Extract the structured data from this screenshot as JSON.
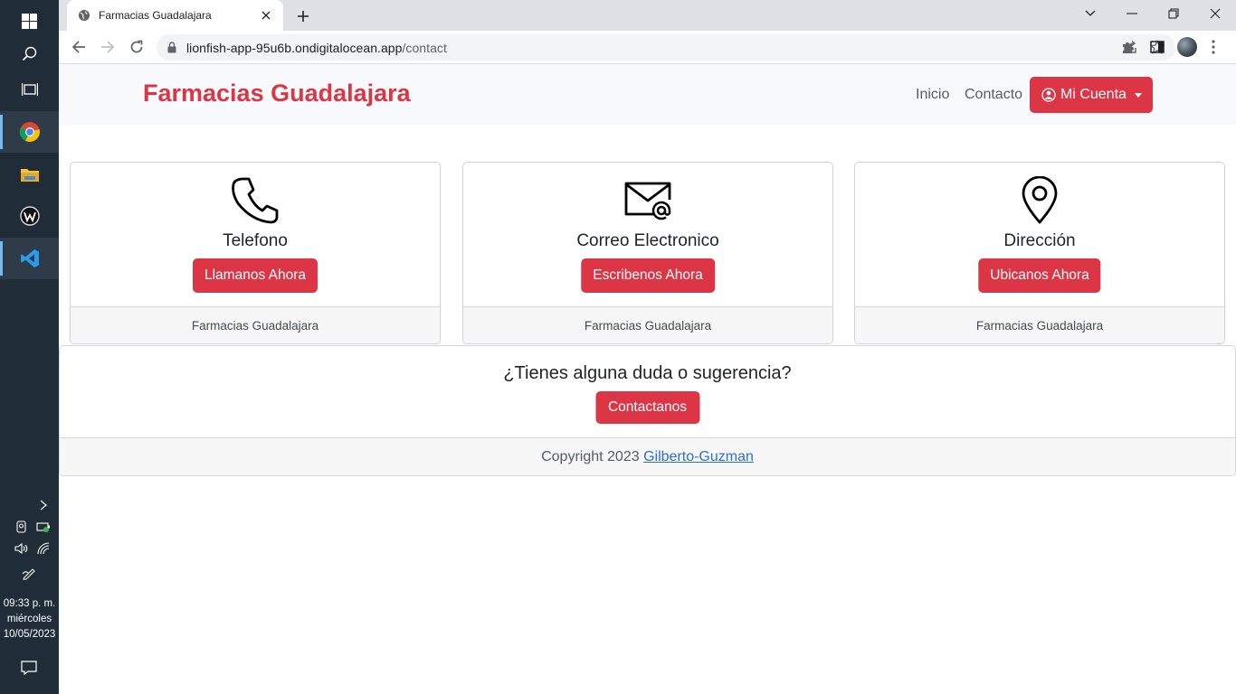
{
  "taskbar": {
    "clock_time": "09:33 p. m.",
    "clock_day": "miércoles",
    "clock_date": "10/05/2023"
  },
  "browser": {
    "tab_title": "Farmacias Guadalajara",
    "url_host": "lionfish-app-95u6b.ondigitalocean.app",
    "url_path": "/contact"
  },
  "navbar": {
    "brand": "Farmacias Guadalajara",
    "links": [
      "Inicio",
      "Contacto"
    ],
    "account_label": "Mi Cuenta"
  },
  "cards": [
    {
      "icon": "phone-icon",
      "title": "Telefono",
      "button": "Llamanos Ahora",
      "footer": "Farmacias Guadalajara"
    },
    {
      "icon": "envelope-at-icon",
      "title": "Correo Electronico",
      "button": "Escribenos Ahora",
      "footer": "Farmacias Guadalajara"
    },
    {
      "icon": "geo-pin-icon",
      "title": "Dirección",
      "button": "Ubicanos Ahora",
      "footer": "Farmacias Guadalajara"
    }
  ],
  "contact": {
    "question": "¿Tienes alguna duda o sugerencia?",
    "button": "Contactanos"
  },
  "footer": {
    "copyright": "Copyright 2023",
    "author": "Gilberto-Guzman"
  },
  "colors": {
    "brand_red": "#dc3545",
    "navbar_bg": "#f8f9fa",
    "taskbar_bg": "#202c38"
  }
}
